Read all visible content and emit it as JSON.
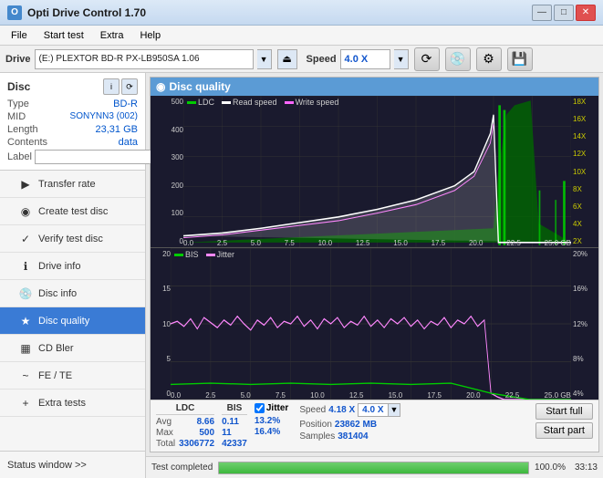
{
  "titlebar": {
    "title": "Opti Drive Control 1.70",
    "minimize_label": "—",
    "maximize_label": "□",
    "close_label": "✕"
  },
  "menubar": {
    "items": [
      {
        "id": "file",
        "label": "File"
      },
      {
        "id": "start-test",
        "label": "Start test"
      },
      {
        "id": "extra",
        "label": "Extra"
      },
      {
        "id": "help",
        "label": "Help"
      }
    ]
  },
  "drivebar": {
    "drive_label": "Drive",
    "drive_value": "(E:)  PLEXTOR BD-R  PX-LB950SA 1.06",
    "speed_label": "Speed",
    "speed_value": "4.0 X"
  },
  "disc": {
    "title": "Disc",
    "type_label": "Type",
    "type_value": "BD-R",
    "mid_label": "MID",
    "mid_value": "SONYNN3 (002)",
    "length_label": "Length",
    "length_value": "23,31 GB",
    "contents_label": "Contents",
    "contents_value": "data",
    "label_label": "Label",
    "label_value": ""
  },
  "nav": {
    "items": [
      {
        "id": "transfer-rate",
        "label": "Transfer rate",
        "icon": "▶"
      },
      {
        "id": "create-test-disc",
        "label": "Create test disc",
        "icon": "◉"
      },
      {
        "id": "verify-test-disc",
        "label": "Verify test disc",
        "icon": "✓"
      },
      {
        "id": "drive-info",
        "label": "Drive info",
        "icon": "ℹ"
      },
      {
        "id": "disc-info",
        "label": "Disc info",
        "icon": "💿"
      },
      {
        "id": "disc-quality",
        "label": "Disc quality",
        "icon": "★",
        "active": true
      },
      {
        "id": "cd-bler",
        "label": "CD Bler",
        "icon": "▦"
      },
      {
        "id": "fe-te",
        "label": "FE / TE",
        "icon": "~"
      },
      {
        "id": "extra-tests",
        "label": "Extra tests",
        "icon": "+"
      }
    ]
  },
  "status_window": {
    "label": "Status window >> "
  },
  "chart": {
    "title": "Disc quality",
    "icon": "◉",
    "top_legend": [
      {
        "id": "ldc",
        "label": "LDC",
        "color": "#00cc00"
      },
      {
        "id": "read-speed",
        "label": "Read speed",
        "color": "#ffffff"
      },
      {
        "id": "write-speed",
        "label": "Write speed",
        "color": "#ff66ff"
      }
    ],
    "bottom_legend": [
      {
        "id": "bis",
        "label": "BIS",
        "color": "#00cc00"
      },
      {
        "id": "jitter",
        "label": "Jitter",
        "color": "#ff88ff"
      }
    ],
    "top_y_left": [
      "500",
      "400",
      "300",
      "200",
      "100",
      "0"
    ],
    "top_y_right": [
      "18X",
      "16X",
      "14X",
      "12X",
      "10X",
      "8X",
      "6X",
      "4X",
      "2X"
    ],
    "bottom_y_left": [
      "20",
      "15",
      "10",
      "5",
      "0"
    ],
    "bottom_y_right": [
      "20%",
      "16%",
      "12%",
      "8%",
      "4%"
    ],
    "x_axis": [
      "0.0",
      "2.5",
      "5.0",
      "7.5",
      "10.0",
      "12.5",
      "15.0",
      "17.5",
      "20.0",
      "22.5",
      "25.0 GB"
    ]
  },
  "stats": {
    "avg_label": "Avg",
    "max_label": "Max",
    "total_label": "Total",
    "ldc_header": "LDC",
    "bis_header": "BIS",
    "jitter_header": "Jitter",
    "speed_label": "Speed",
    "position_label": "Position",
    "samples_label": "Samples",
    "avg_ldc": "8.66",
    "max_ldc": "500",
    "total_ldc": "3306772",
    "avg_bis": "0.11",
    "max_bis": "11",
    "total_bis": "42337",
    "avg_jitter": "13.2%",
    "max_jitter": "16.4%",
    "speed_val": "4.18 X",
    "speed_sel": "4.0 X",
    "position_val": "23862 MB",
    "samples_val": "381404",
    "jitter_checked": true,
    "jitter_label": "Jitter",
    "start_full_label": "Start full",
    "start_part_label": "Start part"
  },
  "progress": {
    "status_text": "Test completed",
    "percent": "100.0%",
    "time": "33:13"
  }
}
